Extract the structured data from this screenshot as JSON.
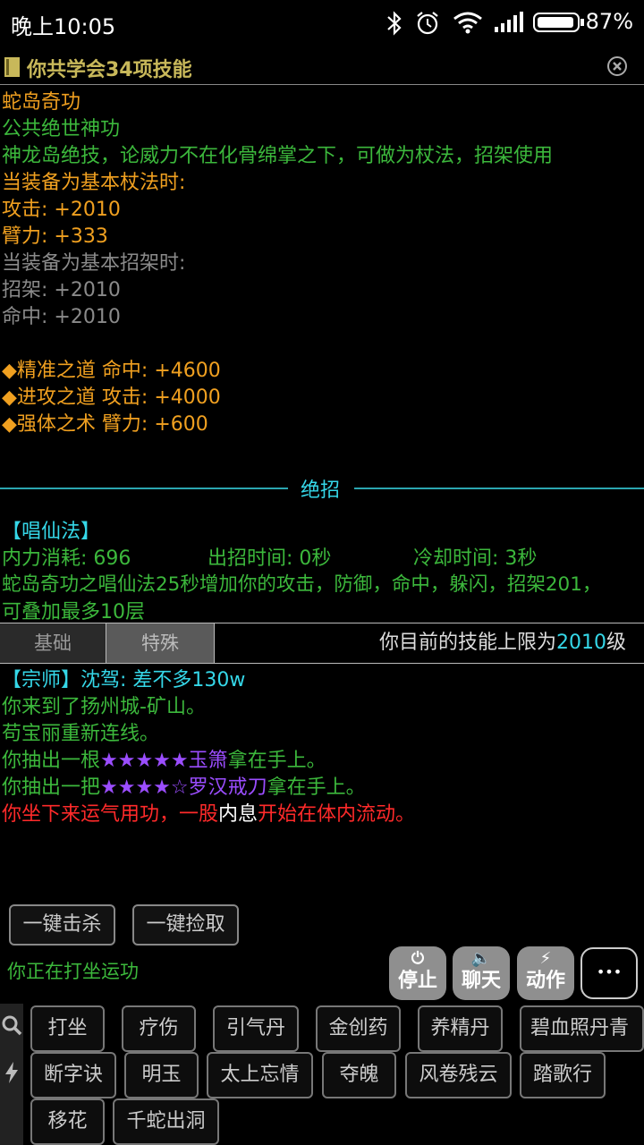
{
  "status_bar": {
    "time": "晚上10:05",
    "battery": "87%"
  },
  "skill_panel": {
    "title": "你共学会34项技能",
    "skill_name": "蛇岛奇功",
    "category": "公共绝世神功",
    "description": "神龙岛绝技，论威力不在化骨绵掌之下，可做为杖法，招架使用",
    "equip_staff_header": "当装备为基本杖法时:",
    "attack_bonus": "攻击: +2010",
    "arm_bonus": "臂力: +333",
    "equip_parry_header": "当装备为基本招架时:",
    "parry_bonus": "招架: +2010",
    "hit_bonus": "命中: +2010",
    "passives": [
      {
        "icon": "diamond-icon",
        "text": "精准之道  命中: +4600"
      },
      {
        "icon": "diamond-icon",
        "text": "进攻之道  攻击: +4000"
      },
      {
        "icon": "diamond-icon",
        "text": "强体之术  臂力: +600"
      }
    ],
    "section_title": "绝招",
    "move_name": "【唱仙法】",
    "mana_cost": "内力消耗: 696",
    "cast_time": "出招时间: 0秒",
    "cooldown": "冷却时间: 3秒",
    "move_desc_1": "蛇岛奇功之唱仙法25秒增加你的攻击，防御，命中，躲闪，招架201，",
    "move_desc_2": "可叠加最多10层"
  },
  "tabs": {
    "basic": "基础",
    "special": "特殊",
    "limit_prefix": "你目前的技能上限为",
    "limit_value": "2010",
    "limit_suffix": "级"
  },
  "log": {
    "line1_tag": "【宗师】",
    "line1_text": "沈驾: 差不多130w",
    "line2": "你来到了扬州城-矿山。",
    "line3": "苟宝丽重新连线。",
    "line4_pre": "你抽出一根",
    "line4_stars": "★★★★★",
    "line4_item": "玉箫",
    "line4_post": "拿在手上。",
    "line5_pre": "你抽出一把",
    "line5_stars": "★★★★☆",
    "line5_item": "罗汉戒刀",
    "line5_post": "拿在手上。",
    "line6_a": "你坐下来运气用功，一股",
    "line6_b": "内息",
    "line6_c": "开始在体内流动。"
  },
  "quick_actions": {
    "kill_all": "一键击杀",
    "pick_all": "一键捡取"
  },
  "state_text": "你正在打坐运功",
  "round_buttons": {
    "stop": "停止",
    "chat": "聊天",
    "action": "动作",
    "more": "•••"
  },
  "skills": [
    "打坐",
    "疗伤",
    "引气丹",
    "金创药",
    "养精丹",
    "碧血照丹青",
    "断字诀",
    "明玉",
    "太上忘情",
    "夺魄",
    "风卷残云",
    "踏歌行",
    "移花",
    "千蛇出洞"
  ],
  "colors": {
    "orange": "#f0a020",
    "green": "#3cb83c",
    "cyan": "#35d7e8",
    "purple": "#9b4dff",
    "red": "#ff2a2a"
  }
}
